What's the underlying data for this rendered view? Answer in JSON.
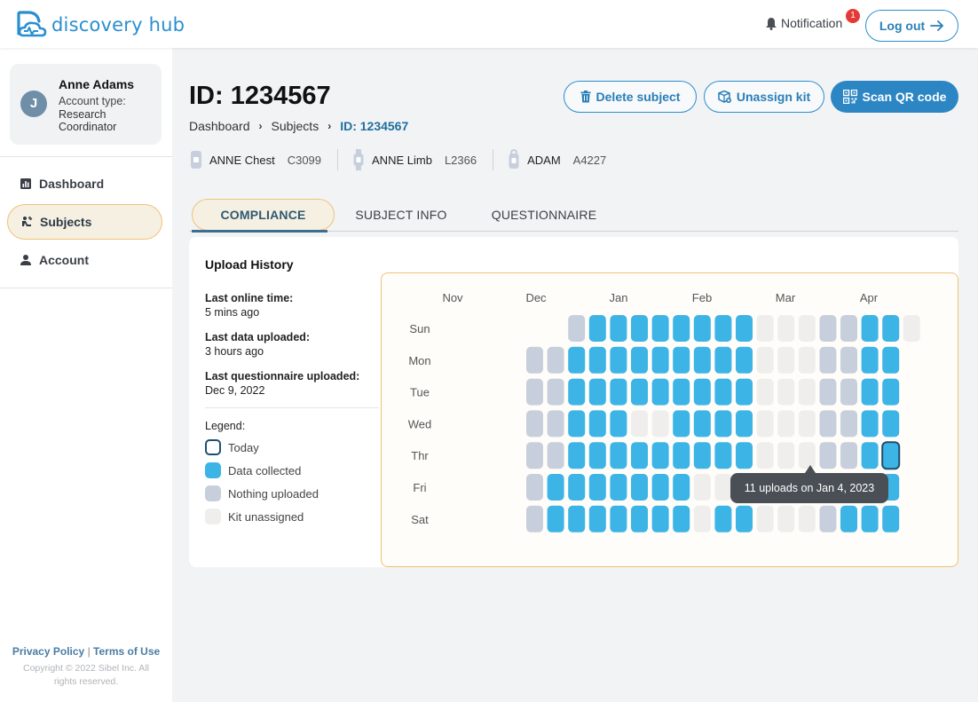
{
  "app": {
    "logo_text": "discovery hub",
    "notification_label": "Notification",
    "notification_count": "1",
    "logout_label": "Log out"
  },
  "user": {
    "initial": "J",
    "name": "Anne Adams",
    "type_label": "Account type:",
    "type_value": "Research Coordinator"
  },
  "nav": [
    {
      "label": "Dashboard",
      "icon": "chart-icon"
    },
    {
      "label": "Subjects",
      "icon": "subjects-icon",
      "active": true
    },
    {
      "label": "Account",
      "icon": "person-icon"
    }
  ],
  "footer": {
    "privacy": "Privacy Policy",
    "sep": "|",
    "terms": "Terms of Use",
    "copyright": "Copyright © 2022 Sibel Inc. All rights reserved."
  },
  "page": {
    "title": "ID: 1234567",
    "breadcrumb": [
      "Dashboard",
      "Subjects",
      "ID: 1234567"
    ],
    "actions": {
      "delete": "Delete subject",
      "unassign": "Unassign kit",
      "scan": "Scan QR code"
    },
    "devices": [
      {
        "name": "ANNE Chest",
        "code": "C3099"
      },
      {
        "name": "ANNE Limb",
        "code": "L2366"
      },
      {
        "name": "ADAM",
        "code": "A4227"
      }
    ],
    "tabs": [
      "COMPLIANCE",
      "SUBJECT INFO",
      "QUESTIONNAIRE"
    ]
  },
  "upload_history": {
    "title": "Upload History",
    "last_online_label": "Last online time:",
    "last_online_value": "5 mins ago",
    "last_data_label": "Last data uploaded:",
    "last_data_value": "3 hours ago",
    "last_questionnaire_label": "Last questionnaire uploaded:",
    "last_questionnaire_value": "Dec 9, 2022",
    "legend_title": "Legend:",
    "legend": {
      "today": "Today",
      "collected": "Data collected",
      "nothing": "Nothing uploaded",
      "unassigned": "Kit unassigned"
    },
    "tooltip": "11 uploads on Jan 4, 2023"
  },
  "colors": {
    "collected": "#3db4e6",
    "nothing": "#c8cfdc",
    "unassigned": "#efeeec",
    "today_border": "#1f4f6f",
    "accent": "#2c86c4"
  },
  "calendar": {
    "months": [
      "Nov",
      "Dec",
      "Jan",
      "Feb",
      "Mar",
      "Apr"
    ],
    "days": [
      "Sun",
      "Mon",
      "Tue",
      "Wed",
      "Thr",
      "Fri",
      "Sat"
    ],
    "week_count": 20,
    "grid": [
      "....GBBBBBBBBUUUGGBBU",
      "...GGBBBBBBBBBUUUGGBB",
      "...GGBBBBBBBBBUUUGGBB",
      "...GGBBBUUBBBBUUUGGBB",
      "...GGBBBBBBBBBUUUGGBT",
      "...GBBBBBBBUUBBUUUGBB.",
      "...GBBBBBBBUBBUUUGBBB."
    ]
  }
}
